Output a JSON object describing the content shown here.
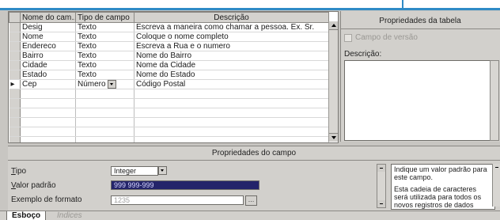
{
  "grid": {
    "headers": [
      "Nome do cam…",
      "Tipo de campo",
      "Descrição"
    ],
    "rows": [
      {
        "marker": "",
        "name": "Desig",
        "type": "Texto",
        "desc": "Escreva a maneira como chamar a pessoa. Ex. Sr."
      },
      {
        "marker": "",
        "name": "Nome",
        "type": "Texto",
        "desc": "Coloque o nome completo"
      },
      {
        "marker": "",
        "name": "Endereco",
        "type": "Texto",
        "desc": "Escreva a Rua e o numero"
      },
      {
        "marker": "",
        "name": "Bairro",
        "type": "Texto",
        "desc": "Nome do Bairro"
      },
      {
        "marker": "",
        "name": "Cidade",
        "type": "Texto",
        "desc": "Nome da Cidade"
      },
      {
        "marker": "",
        "name": "Estado",
        "type": "Texto",
        "desc": "Nome do Estado"
      },
      {
        "marker": "▸",
        "name": "Cep",
        "type": "Número",
        "desc": "Código Postal"
      }
    ]
  },
  "table_props": {
    "title": "Propriedades da tabela",
    "checkbox_label": "Campo de versão",
    "desc_label": "Descrição:"
  },
  "field_props": {
    "title": "Propriedades do campo",
    "tipo_label_u": "T",
    "tipo_label_rest": "ipo",
    "tipo_value": "Integer",
    "default_label_u": "V",
    "default_label_rest": "alor padrão",
    "default_value": "999 999-999",
    "format_label": "Exemplo de formato",
    "format_value": "1235",
    "help_p1": "Indique um valor padrão para este campo.",
    "help_p2": "Esta cadeia de caracteres será utilizada para todos os novos registros de dados"
  },
  "tabs": {
    "active": "Esboço",
    "inactive": "Índices"
  }
}
